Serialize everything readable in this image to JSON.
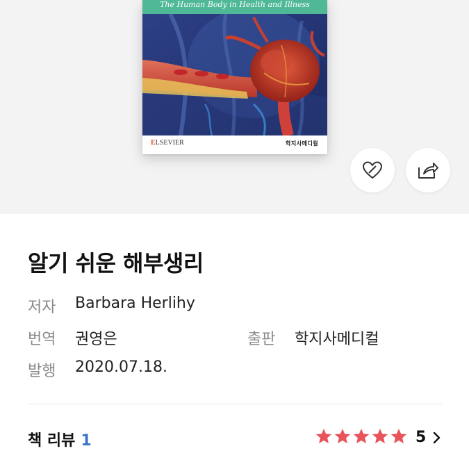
{
  "cover": {
    "subtitle": "The Human Body in Health and Illness",
    "publisher_left": "ELSEVIER",
    "publisher_right": "학지사메디컬"
  },
  "actions": {
    "like_icon": "heart-icon",
    "share_icon": "share-icon"
  },
  "book": {
    "title": "알기 쉬운 해부생리",
    "author_label": "저자",
    "author": "Barbara Herlihy",
    "translator_label": "번역",
    "translator": "권영은",
    "publisher_label": "출판",
    "publisher": "학지사메디컬",
    "date_label": "발행",
    "date": "2020.07.18."
  },
  "review": {
    "label": "책 리뷰",
    "count": "1",
    "rating": 5,
    "rating_text": "5",
    "star_color": "#e8545a"
  }
}
